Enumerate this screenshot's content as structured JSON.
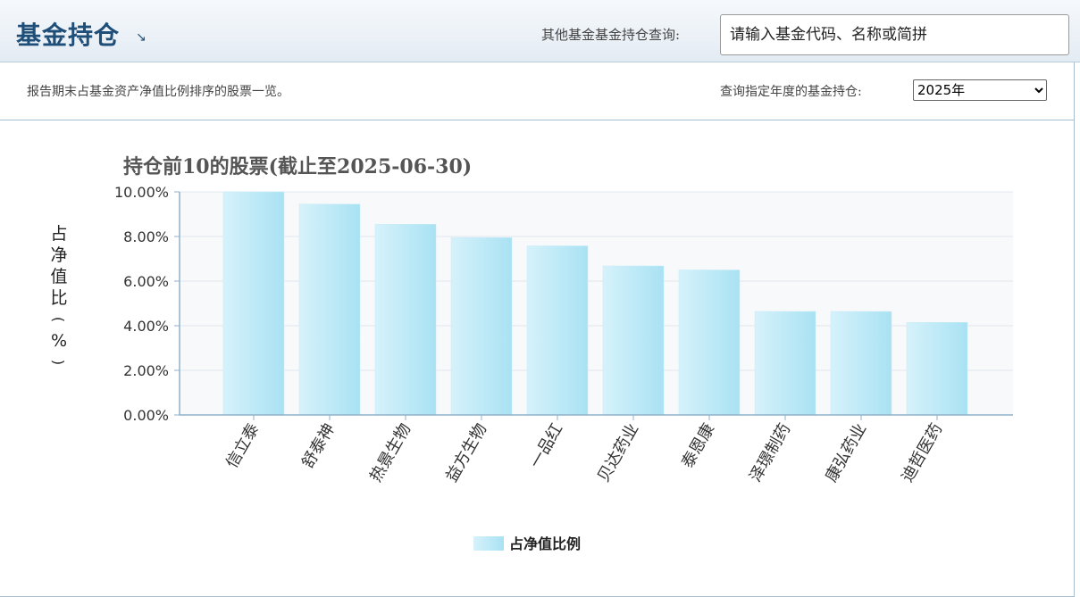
{
  "header": {
    "title": "基金持仓",
    "title_icon": "arrow-down-right-icon",
    "query_label": "其他基金基金持仓查询:",
    "search_placeholder": "请输入基金代码、名称或简拼"
  },
  "subbar": {
    "description": "报告期末占基金资产净值比例排序的股票一览。",
    "year_label": "查询指定年度的基金持仓:",
    "year_selected": "2025年"
  },
  "colors": {
    "title": "#1f4e79",
    "bar_light": "#d6f2fb",
    "bar_dark": "#a9e2f3",
    "plot_bg": "#f7f9fb",
    "axis": "#8fb2c9"
  },
  "chart_data": {
    "type": "bar",
    "title": "持仓前10的股票(截止至2025-06-30)",
    "ylabel": "占净值比(%)",
    "xlabel": "",
    "categories": [
      "信立泰",
      "舒泰神",
      "热景生物",
      "益方生物",
      "一品红",
      "贝达药业",
      "泰恩康",
      "泽璟制药",
      "康弘药业",
      "迪哲医药"
    ],
    "series": [
      {
        "name": "占净值比例",
        "values": [
          10.0,
          9.45,
          8.55,
          7.95,
          7.58,
          6.68,
          6.5,
          4.64,
          4.64,
          4.15
        ]
      }
    ],
    "ylim": [
      0,
      10
    ],
    "yticks": [
      "0.00%",
      "2.00%",
      "4.00%",
      "6.00%",
      "8.00%",
      "10.00%"
    ],
    "grid": true,
    "legend": "bottom-center"
  }
}
